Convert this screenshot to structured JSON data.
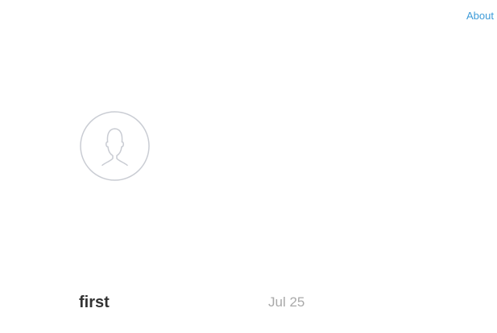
{
  "header": {
    "about_label": "About"
  },
  "profile": {
    "avatar_icon": "user-silhouette-icon"
  },
  "posts": [
    {
      "title": "first",
      "date": "Jul 25"
    }
  ],
  "colors": {
    "link": "#3d9bd8",
    "title": "#333333",
    "date": "#a9a9a9",
    "avatar_stroke": "#c9ccd3",
    "background": "#ffffff"
  }
}
